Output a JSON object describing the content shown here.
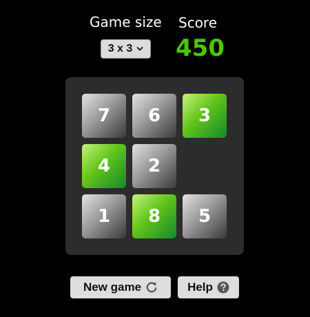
{
  "header": {
    "size_label": "Game size",
    "score_label": "Score",
    "size_value": "3 x 3",
    "score_value": "450"
  },
  "board": {
    "grid": "3x3",
    "tiles": [
      {
        "row": 0,
        "col": 0,
        "value": "7",
        "style": "gray"
      },
      {
        "row": 0,
        "col": 1,
        "value": "6",
        "style": "gray"
      },
      {
        "row": 0,
        "col": 2,
        "value": "3",
        "style": "green"
      },
      {
        "row": 1,
        "col": 0,
        "value": "4",
        "style": "green"
      },
      {
        "row": 1,
        "col": 1,
        "value": "2",
        "style": "gray"
      },
      {
        "row": 2,
        "col": 0,
        "value": "1",
        "style": "gray"
      },
      {
        "row": 2,
        "col": 1,
        "value": "8",
        "style": "green"
      },
      {
        "row": 2,
        "col": 2,
        "value": "5",
        "style": "gray"
      }
    ],
    "empty_cell": {
      "row": 1,
      "col": 2
    }
  },
  "buttons": {
    "new_game": "New game",
    "help": "Help"
  },
  "icons": {
    "size_dropdown": "chevron-down-icon",
    "new_game": "refresh-icon",
    "help": "question-circle-icon"
  },
  "colors": {
    "background": "#000000",
    "score": "#4ac60a",
    "board": "#2c2c2c",
    "tile_green": "#62c41a",
    "tile_gray": "#9a9a9a",
    "button": "#dedede"
  }
}
